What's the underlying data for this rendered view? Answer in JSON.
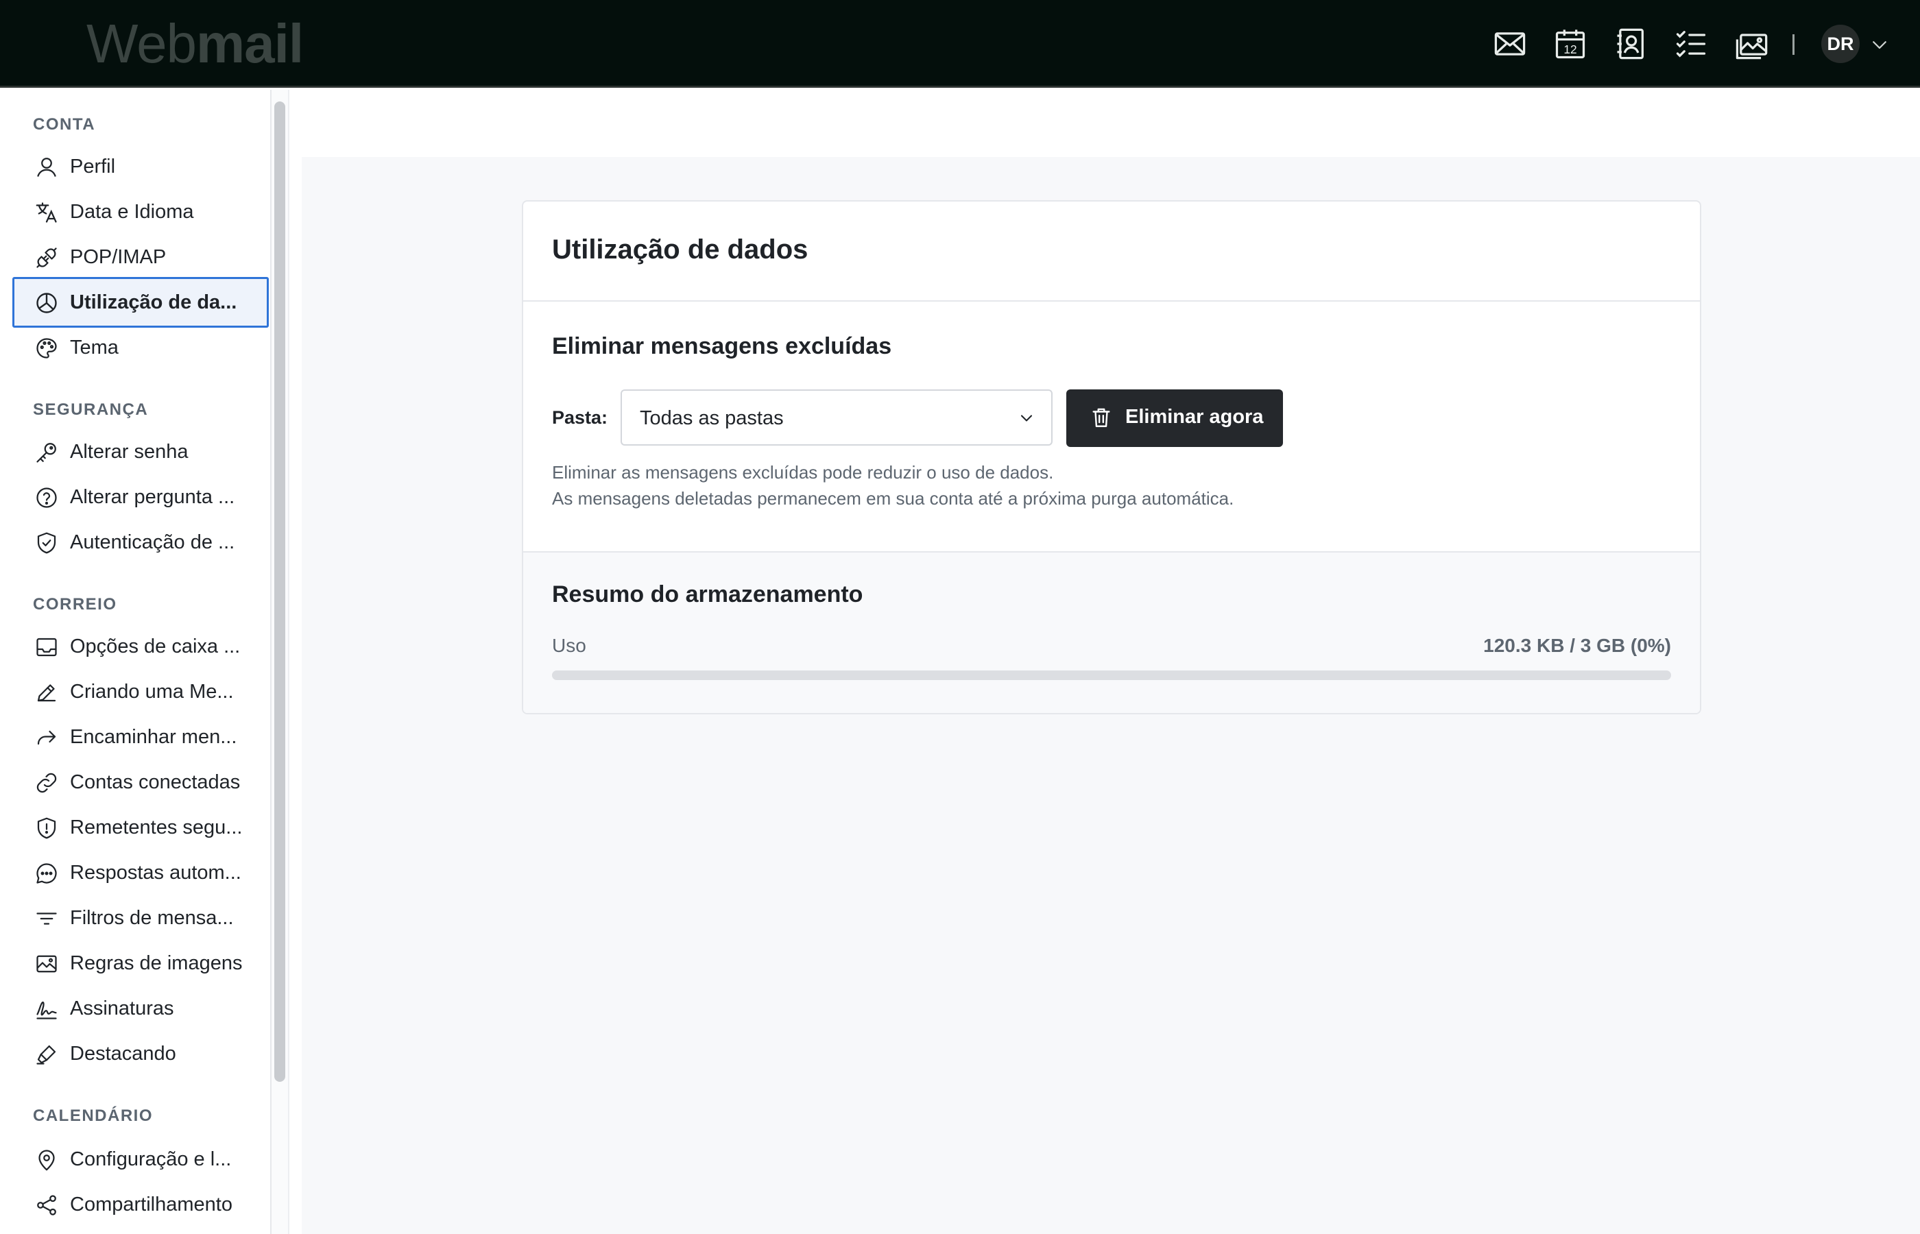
{
  "app": {
    "logo_part1": "Web",
    "logo_part2": "mail"
  },
  "topbar": {
    "icons": [
      "mail-icon",
      "calendar-icon",
      "contacts-icon",
      "tasks-icon",
      "photos-icon"
    ],
    "calendar_day": "12",
    "avatar_initials": "DR"
  },
  "sidebar": {
    "sections": [
      {
        "title": "CONTA",
        "items": [
          {
            "label": "Perfil",
            "icon": "user-icon"
          },
          {
            "label": "Data e Idioma",
            "icon": "translate-icon"
          },
          {
            "label": "POP/IMAP",
            "icon": "plug-icon"
          },
          {
            "label": "Utilização de da...",
            "icon": "pie-chart-icon",
            "active": true
          },
          {
            "label": "Tema",
            "icon": "palette-icon"
          }
        ]
      },
      {
        "title": "SEGURANÇA",
        "items": [
          {
            "label": "Alterar senha",
            "icon": "key-icon"
          },
          {
            "label": "Alterar pergunta ...",
            "icon": "question-icon"
          },
          {
            "label": "Autenticação de ...",
            "icon": "shield-check-icon"
          }
        ]
      },
      {
        "title": "CORREIO",
        "items": [
          {
            "label": "Opções de caixa ...",
            "icon": "inbox-icon"
          },
          {
            "label": "Criando uma Me...",
            "icon": "pencil-icon"
          },
          {
            "label": "Encaminhar men...",
            "icon": "forward-icon"
          },
          {
            "label": "Contas conectadas",
            "icon": "link-icon"
          },
          {
            "label": "Remetentes segu...",
            "icon": "shield-alert-icon"
          },
          {
            "label": "Respostas autom...",
            "icon": "chat-icon"
          },
          {
            "label": "Filtros de mensa...",
            "icon": "filter-icon"
          },
          {
            "label": "Regras de imagens",
            "icon": "image-icon"
          },
          {
            "label": "Assinaturas",
            "icon": "signature-icon"
          },
          {
            "label": "Destacando",
            "icon": "highlighter-icon"
          }
        ]
      },
      {
        "title": "CALENDÁRIO",
        "items": [
          {
            "label": "Configuração e l...",
            "icon": "location-icon"
          },
          {
            "label": "Compartilhamento",
            "icon": "share-icon"
          }
        ]
      }
    ]
  },
  "main": {
    "title": "Utilização de dados",
    "purge": {
      "title": "Eliminar mensagens excluídas",
      "folder_label": "Pasta:",
      "folder_value": "Todas as pastas",
      "button_label": "Eliminar agora",
      "help_line1": "Eliminar as mensagens excluídas pode reduzir o uso de dados.",
      "help_line2": "As mensagens deletadas permanecem em sua conta até a próxima purga automática."
    },
    "storage": {
      "title": "Resumo do armazenamento",
      "usage_label": "Uso",
      "usage_value": "120.3 KB / 3 GB (0%)",
      "usage_percent": 0
    }
  },
  "colors": {
    "accent": "#2f74d8",
    "topbar": "#040f0c",
    "button": "#25282c"
  }
}
